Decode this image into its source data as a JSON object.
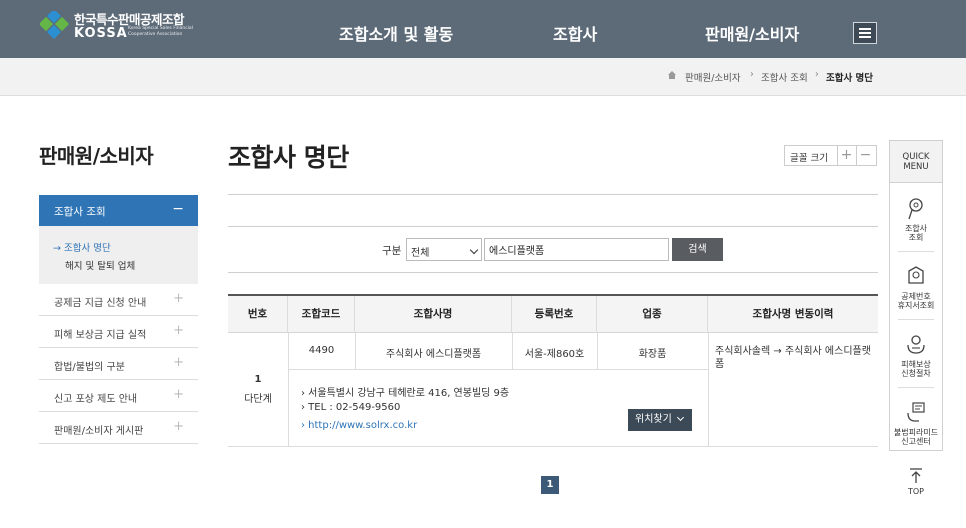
{
  "header": {
    "logo_kr": "한국특수판매공제조합",
    "logo_en": "KOSSA",
    "logo_sub": "Korea Special Sales Financial Cooperative Association",
    "nav": [
      "조합소개 및 활동",
      "조합사",
      "판매원/소비자"
    ],
    "menu_icon": "hamburger-icon"
  },
  "breadcrumb": {
    "home_icon": "home-icon",
    "items": [
      "판매원/소비자",
      "조합사 조회",
      "조합사 명단"
    ]
  },
  "sidebar": {
    "title": "판매원/소비자",
    "section": {
      "label": "조합사 조회",
      "toggle": "−"
    },
    "subitems": [
      "→ 조합사 명단",
      "해지 및 탈퇴 업체"
    ],
    "items": [
      "공제금 지급 신청 안내",
      "피해 보상금 지급 실적",
      "합법/불법의 구분",
      "신고 포상 제도 안내",
      "판매원/소비자 게시판"
    ],
    "item_toggle": "+"
  },
  "main": {
    "title": "조합사 명단",
    "font_size": {
      "label": "글꼴 크기",
      "plus": "+",
      "minus": "−"
    },
    "search": {
      "label": "구분",
      "select_value": "전체",
      "input_value": "에스디플랫폼",
      "button": "검색"
    },
    "table": {
      "headers": [
        "번호",
        "조합코드",
        "조합사명",
        "등록번호",
        "업종",
        "조합사명 변동이력"
      ],
      "rows": [
        {
          "no": "1",
          "tier": "다단계",
          "code": "4490",
          "name": "주식회사 에스디플랫폼",
          "reg": "서울-제860호",
          "type": "화장품",
          "history": "주식회사솔렉 → 주식회사 에스디플랫폼",
          "address": "› 서울특별시 강남구 테헤란로 416, 연봉빌딩 9층",
          "tel": "› TEL : 02-549-9560",
          "url": "› http://www.solrx.co.kr",
          "location_button": "위치찾기"
        }
      ]
    },
    "pagination": {
      "current": "1"
    }
  },
  "quick_menu": {
    "title_line1": "QUICK",
    "title_line2": "MENU",
    "items": [
      {
        "icon": "search-magnifier-icon",
        "line1": "조합사",
        "line2": "조회"
      },
      {
        "icon": "certificate-icon",
        "line1": "공제번호",
        "line2": "휴지서조회"
      },
      {
        "icon": "hands-icon",
        "line1": "피해보상",
        "line2": "신청절차"
      },
      {
        "icon": "megaphone-icon",
        "line1": "불법피라미드",
        "line2": "신고센터"
      }
    ],
    "top_label": "TOP"
  },
  "colors": {
    "header_bg": "#5d6b79",
    "accent_blue": "#2f74b5",
    "search_button": "#595d62",
    "location_button": "#3c4a57"
  }
}
